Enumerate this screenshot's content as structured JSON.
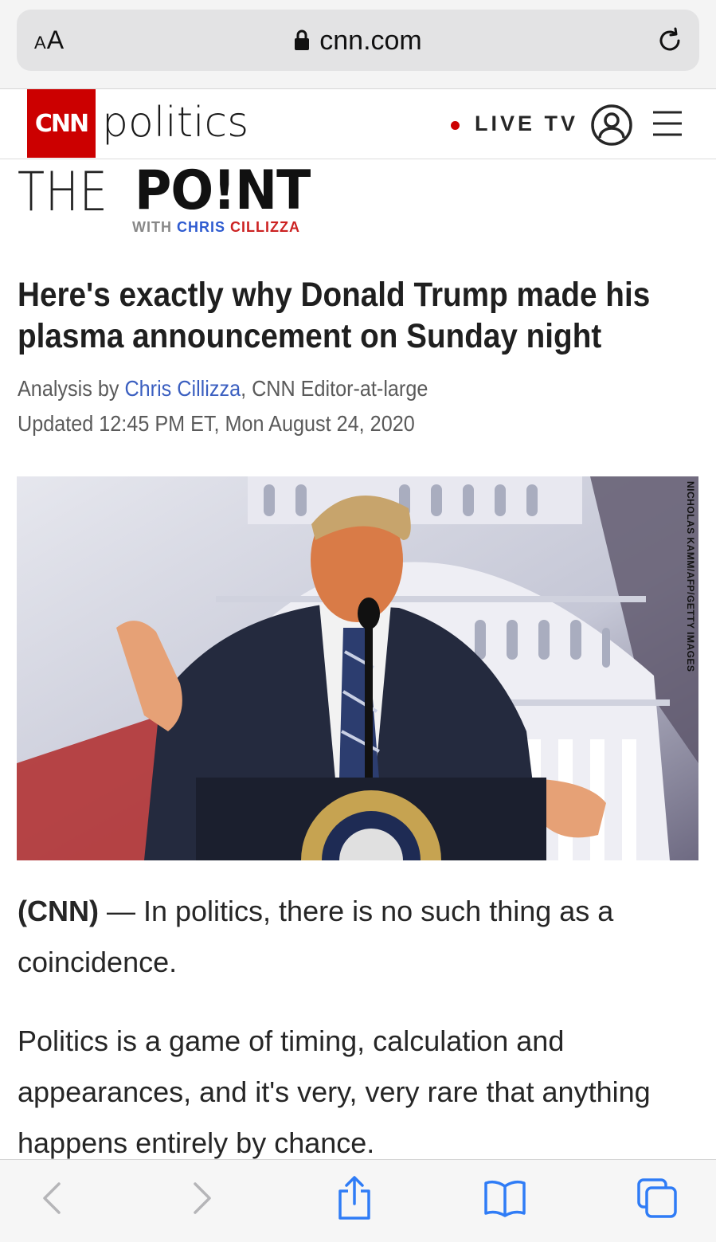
{
  "browser": {
    "text_size_label": "AA",
    "domain": "cnn.com"
  },
  "header": {
    "logo_text": "CNN",
    "section": "politics",
    "live_tv": "LIVE TV"
  },
  "column_logo": {
    "the": "THE",
    "point": "PO!NT",
    "with": "WITH",
    "author_first": "CHRIS",
    "author_last": "CILLIZZA"
  },
  "article": {
    "headline": "Here's exactly why Donald Trump made his plasma announcement on Sunday night",
    "byline_prefix": "Analysis by ",
    "author": "Chris Cillizza",
    "byline_suffix": ", CNN Editor-at-large",
    "updated": "Updated 12:45 PM ET, Mon August 24, 2020",
    "photo_credit": "NICHOLAS KAMM/AFP/GETTY IMAGES",
    "p1_source": "(CNN)",
    "p1_text": " — In politics, there is no such thing as a coincidence.",
    "p2_text": "Politics is a game of timing, calculation and appearances, and it's very, very rare that anything happens entirely by chance."
  },
  "icons": {
    "lock": "lock-icon",
    "reload": "reload-icon",
    "account": "account-icon",
    "menu": "menu-icon",
    "back": "back-icon",
    "forward": "forward-icon",
    "share": "share-icon",
    "bookmarks": "bookmarks-icon",
    "tabs": "tabs-icon"
  },
  "colors": {
    "cnn_red": "#cc0000",
    "link_blue": "#3b5fc0",
    "safari_blue": "#2f7cf6"
  }
}
